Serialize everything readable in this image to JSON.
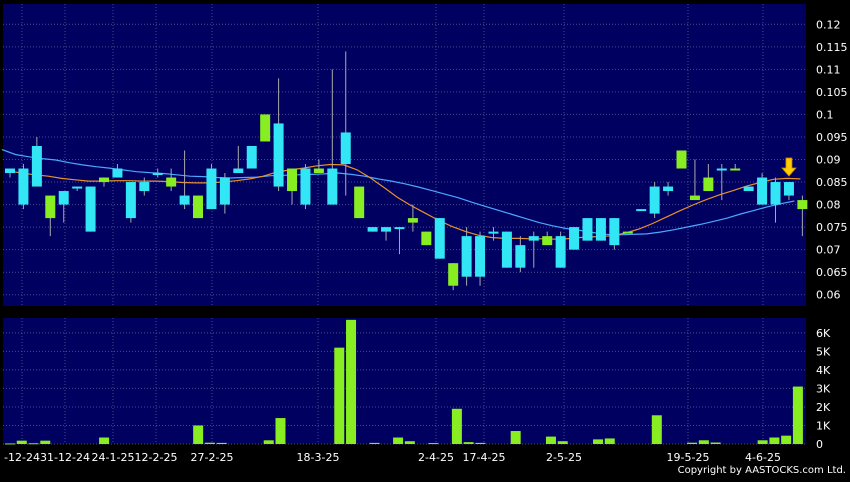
{
  "copyright": "Copyright by AASTOCKS.com Ltd.",
  "colors": {
    "background": "#000000",
    "panel": "#000060",
    "grid": "#4a4a8a",
    "candle_up": "#33e6f5",
    "candle_down": "#88ee22",
    "volume": "#88ee22",
    "sma_short": "#e8902a",
    "sma_long": "#4aa8ff",
    "marker": "#ffcc00",
    "text": "#ffffff"
  },
  "chart_data": [
    {
      "type": "candlestick",
      "yticks": [
        "0.06",
        "0.065",
        "0.07",
        "0.075",
        "0.08",
        "0.085",
        "0.09",
        "0.095",
        "0.1",
        "0.105",
        "0.11",
        "0.115",
        "0.12"
      ],
      "ylim": [
        0.0575,
        0.1245
      ],
      "grid": true,
      "candles": [
        {
          "o": 0.087,
          "h": 0.088,
          "l": 0.086,
          "c": 0.088,
          "dir": "up"
        },
        {
          "o": 0.08,
          "h": 0.089,
          "l": 0.079,
          "c": 0.088,
          "dir": "up"
        },
        {
          "o": 0.084,
          "h": 0.095,
          "l": 0.084,
          "c": 0.093,
          "dir": "up"
        },
        {
          "o": 0.082,
          "h": 0.082,
          "l": 0.073,
          "c": 0.077,
          "dir": "down"
        },
        {
          "o": 0.08,
          "h": 0.083,
          "l": 0.076,
          "c": 0.083,
          "dir": "up"
        },
        {
          "o": 0.084,
          "h": 0.084,
          "l": 0.083,
          "c": 0.084,
          "dir": "up"
        },
        {
          "o": 0.074,
          "h": 0.084,
          "l": 0.074,
          "c": 0.084,
          "dir": "up"
        },
        {
          "o": 0.086,
          "h": 0.086,
          "l": 0.084,
          "c": 0.085,
          "dir": "down"
        },
        {
          "o": 0.086,
          "h": 0.089,
          "l": 0.086,
          "c": 0.088,
          "dir": "up"
        },
        {
          "o": 0.077,
          "h": 0.085,
          "l": 0.076,
          "c": 0.085,
          "dir": "up"
        },
        {
          "o": 0.083,
          "h": 0.086,
          "l": 0.082,
          "c": 0.085,
          "dir": "up"
        },
        {
          "o": 0.087,
          "h": 0.088,
          "l": 0.086,
          "c": 0.087,
          "dir": "up"
        },
        {
          "o": 0.086,
          "h": 0.088,
          "l": 0.083,
          "c": 0.084,
          "dir": "down"
        },
        {
          "o": 0.08,
          "h": 0.092,
          "l": 0.079,
          "c": 0.082,
          "dir": "up"
        },
        {
          "o": 0.082,
          "h": 0.082,
          "l": 0.077,
          "c": 0.077,
          "dir": "down"
        },
        {
          "o": 0.079,
          "h": 0.089,
          "l": 0.079,
          "c": 0.088,
          "dir": "up"
        },
        {
          "o": 0.08,
          "h": 0.087,
          "l": 0.078,
          "c": 0.086,
          "dir": "up"
        },
        {
          "o": 0.087,
          "h": 0.093,
          "l": 0.087,
          "c": 0.088,
          "dir": "up"
        },
        {
          "o": 0.088,
          "h": 0.092,
          "l": 0.088,
          "c": 0.093,
          "dir": "up"
        },
        {
          "o": 0.1,
          "h": 0.1,
          "l": 0.094,
          "c": 0.094,
          "dir": "down"
        },
        {
          "o": 0.084,
          "h": 0.108,
          "l": 0.083,
          "c": 0.098,
          "dir": "up"
        },
        {
          "o": 0.088,
          "h": 0.088,
          "l": 0.08,
          "c": 0.083,
          "dir": "down"
        },
        {
          "o": 0.08,
          "h": 0.089,
          "l": 0.079,
          "c": 0.088,
          "dir": "up"
        },
        {
          "o": 0.088,
          "h": 0.09,
          "l": 0.087,
          "c": 0.087,
          "dir": "down"
        },
        {
          "o": 0.08,
          "h": 0.11,
          "l": 0.08,
          "c": 0.088,
          "dir": "up"
        },
        {
          "o": 0.089,
          "h": 0.114,
          "l": 0.082,
          "c": 0.096,
          "dir": "up"
        },
        {
          "o": 0.084,
          "h": 0.084,
          "l": 0.077,
          "c": 0.077,
          "dir": "down"
        },
        {
          "o": 0.074,
          "h": 0.075,
          "l": 0.074,
          "c": 0.075,
          "dir": "up"
        },
        {
          "o": 0.074,
          "h": 0.075,
          "l": 0.072,
          "c": 0.075,
          "dir": "up"
        },
        {
          "o": 0.075,
          "h": 0.075,
          "l": 0.069,
          "c": 0.075,
          "dir": "up"
        },
        {
          "o": 0.077,
          "h": 0.08,
          "l": 0.074,
          "c": 0.076,
          "dir": "down"
        },
        {
          "o": 0.074,
          "h": 0.074,
          "l": 0.071,
          "c": 0.071,
          "dir": "down"
        },
        {
          "o": 0.068,
          "h": 0.077,
          "l": 0.068,
          "c": 0.077,
          "dir": "up"
        },
        {
          "o": 0.067,
          "h": 0.067,
          "l": 0.061,
          "c": 0.062,
          "dir": "down"
        },
        {
          "o": 0.064,
          "h": 0.075,
          "l": 0.062,
          "c": 0.073,
          "dir": "up"
        },
        {
          "o": 0.064,
          "h": 0.074,
          "l": 0.062,
          "c": 0.073,
          "dir": "up"
        },
        {
          "o": 0.074,
          "h": 0.075,
          "l": 0.072,
          "c": 0.074,
          "dir": "up"
        },
        {
          "o": 0.066,
          "h": 0.074,
          "l": 0.066,
          "c": 0.074,
          "dir": "up"
        },
        {
          "o": 0.066,
          "h": 0.073,
          "l": 0.065,
          "c": 0.071,
          "dir": "up"
        },
        {
          "o": 0.072,
          "h": 0.074,
          "l": 0.066,
          "c": 0.073,
          "dir": "up"
        },
        {
          "o": 0.073,
          "h": 0.074,
          "l": 0.071,
          "c": 0.071,
          "dir": "down"
        },
        {
          "o": 0.066,
          "h": 0.074,
          "l": 0.066,
          "c": 0.073,
          "dir": "up"
        },
        {
          "o": 0.07,
          "h": 0.075,
          "l": 0.07,
          "c": 0.075,
          "dir": "up"
        },
        {
          "o": 0.072,
          "h": 0.077,
          "l": 0.072,
          "c": 0.077,
          "dir": "up"
        },
        {
          "o": 0.072,
          "h": 0.077,
          "l": 0.072,
          "c": 0.077,
          "dir": "up"
        },
        {
          "o": 0.071,
          "h": 0.077,
          "l": 0.07,
          "c": 0.077,
          "dir": "up"
        },
        {
          "o": 0.074,
          "h": 0.074,
          "l": 0.074,
          "c": 0.074,
          "dir": "down"
        },
        {
          "o": 0.079,
          "h": 0.079,
          "l": 0.079,
          "c": 0.079,
          "dir": "up"
        },
        {
          "o": 0.078,
          "h": 0.085,
          "l": 0.077,
          "c": 0.084,
          "dir": "up"
        },
        {
          "o": 0.084,
          "h": 0.085,
          "l": 0.082,
          "c": 0.083,
          "dir": "up"
        },
        {
          "o": 0.092,
          "h": 0.092,
          "l": 0.088,
          "c": 0.088,
          "dir": "down"
        },
        {
          "o": 0.082,
          "h": 0.09,
          "l": 0.081,
          "c": 0.081,
          "dir": "down"
        },
        {
          "o": 0.086,
          "h": 0.089,
          "l": 0.083,
          "c": 0.083,
          "dir": "down"
        },
        {
          "o": 0.088,
          "h": 0.089,
          "l": 0.081,
          "c": 0.088,
          "dir": "up"
        },
        {
          "o": 0.088,
          "h": 0.089,
          "l": 0.088,
          "c": 0.088,
          "dir": "down"
        },
        {
          "o": 0.083,
          "h": 0.084,
          "l": 0.083,
          "c": 0.084,
          "dir": "up"
        },
        {
          "o": 0.08,
          "h": 0.087,
          "l": 0.08,
          "c": 0.086,
          "dir": "up"
        },
        {
          "o": 0.08,
          "h": 0.086,
          "l": 0.076,
          "c": 0.085,
          "dir": "up"
        },
        {
          "o": 0.082,
          "h": 0.085,
          "l": 0.081,
          "c": 0.085,
          "dir": "up"
        },
        {
          "o": 0.081,
          "h": 0.082,
          "l": 0.073,
          "c": 0.079,
          "dir": "down"
        }
      ],
      "sma_short": [
        0.0875,
        0.087,
        0.0866,
        0.0863,
        0.0858,
        0.0855,
        0.0852,
        0.0852,
        0.0853,
        0.0853,
        0.0852,
        0.0852,
        0.0851,
        0.0849,
        0.0848,
        0.0848,
        0.085,
        0.0853,
        0.0857,
        0.0863,
        0.0872,
        0.0877,
        0.0881,
        0.0886,
        0.0889,
        0.0888,
        0.0877,
        0.0859,
        0.0838,
        0.0816,
        0.0798,
        0.0782,
        0.0766,
        0.0752,
        0.0741,
        0.0732,
        0.0727,
        0.0725,
        0.0725,
        0.0724,
        0.0724,
        0.0723,
        0.0725,
        0.0728,
        0.0729,
        0.0731,
        0.0737,
        0.0746,
        0.0758,
        0.0772,
        0.0786,
        0.0799,
        0.0811,
        0.0822,
        0.0831,
        0.0841,
        0.0849,
        0.0856,
        0.0858,
        0.0857
      ],
      "sma_long": [
        0.0922,
        0.0911,
        0.0906,
        0.0902,
        0.0899,
        0.0893,
        0.0888,
        0.0884,
        0.0881,
        0.0877,
        0.0873,
        0.0871,
        0.0869,
        0.0866,
        0.0863,
        0.0862,
        0.086,
        0.0859,
        0.086,
        0.0861,
        0.0864,
        0.0865,
        0.0866,
        0.0867,
        0.0868,
        0.087,
        0.0867,
        0.0863,
        0.0857,
        0.0852,
        0.0846,
        0.0839,
        0.0831,
        0.0823,
        0.0815,
        0.0805,
        0.0796,
        0.0787,
        0.0778,
        0.0769,
        0.076,
        0.0753,
        0.0747,
        0.0743,
        0.0738,
        0.0734,
        0.0733,
        0.0734,
        0.0735,
        0.0739,
        0.0744,
        0.075,
        0.0756,
        0.0763,
        0.077,
        0.0779,
        0.0787,
        0.0795,
        0.0802,
        0.0808
      ],
      "marker_index": 58
    },
    {
      "type": "bar",
      "yticks": [
        "0",
        "1K",
        "2K",
        "3K",
        "4K",
        "5K",
        "6K"
      ],
      "ylim": [
        0,
        6800
      ],
      "grid": true,
      "values": [
        30,
        180,
        40,
        180,
        0,
        0,
        0,
        0,
        350,
        0,
        0,
        0,
        0,
        0,
        0,
        0,
        1000,
        70,
        60,
        0,
        0,
        0,
        200,
        1400,
        0,
        0,
        0,
        0,
        5200,
        6700,
        0,
        60,
        0,
        350,
        150,
        0,
        50,
        0,
        1900,
        100,
        60,
        0,
        0,
        700,
        0,
        0,
        400,
        150,
        0,
        0,
        250,
        300,
        0,
        0,
        0,
        1550,
        0,
        0,
        70,
        200,
        80,
        0,
        0,
        0,
        200,
        350,
        450,
        3100
      ],
      "xticks": [
        "-12-24",
        "31-12-24",
        "24-1-25",
        "12-2-25",
        "27-2-25",
        "18-3-25",
        "2-4-25",
        "17-4-25",
        "2-5-25",
        "19-5-25",
        "4-6-25"
      ]
    }
  ]
}
